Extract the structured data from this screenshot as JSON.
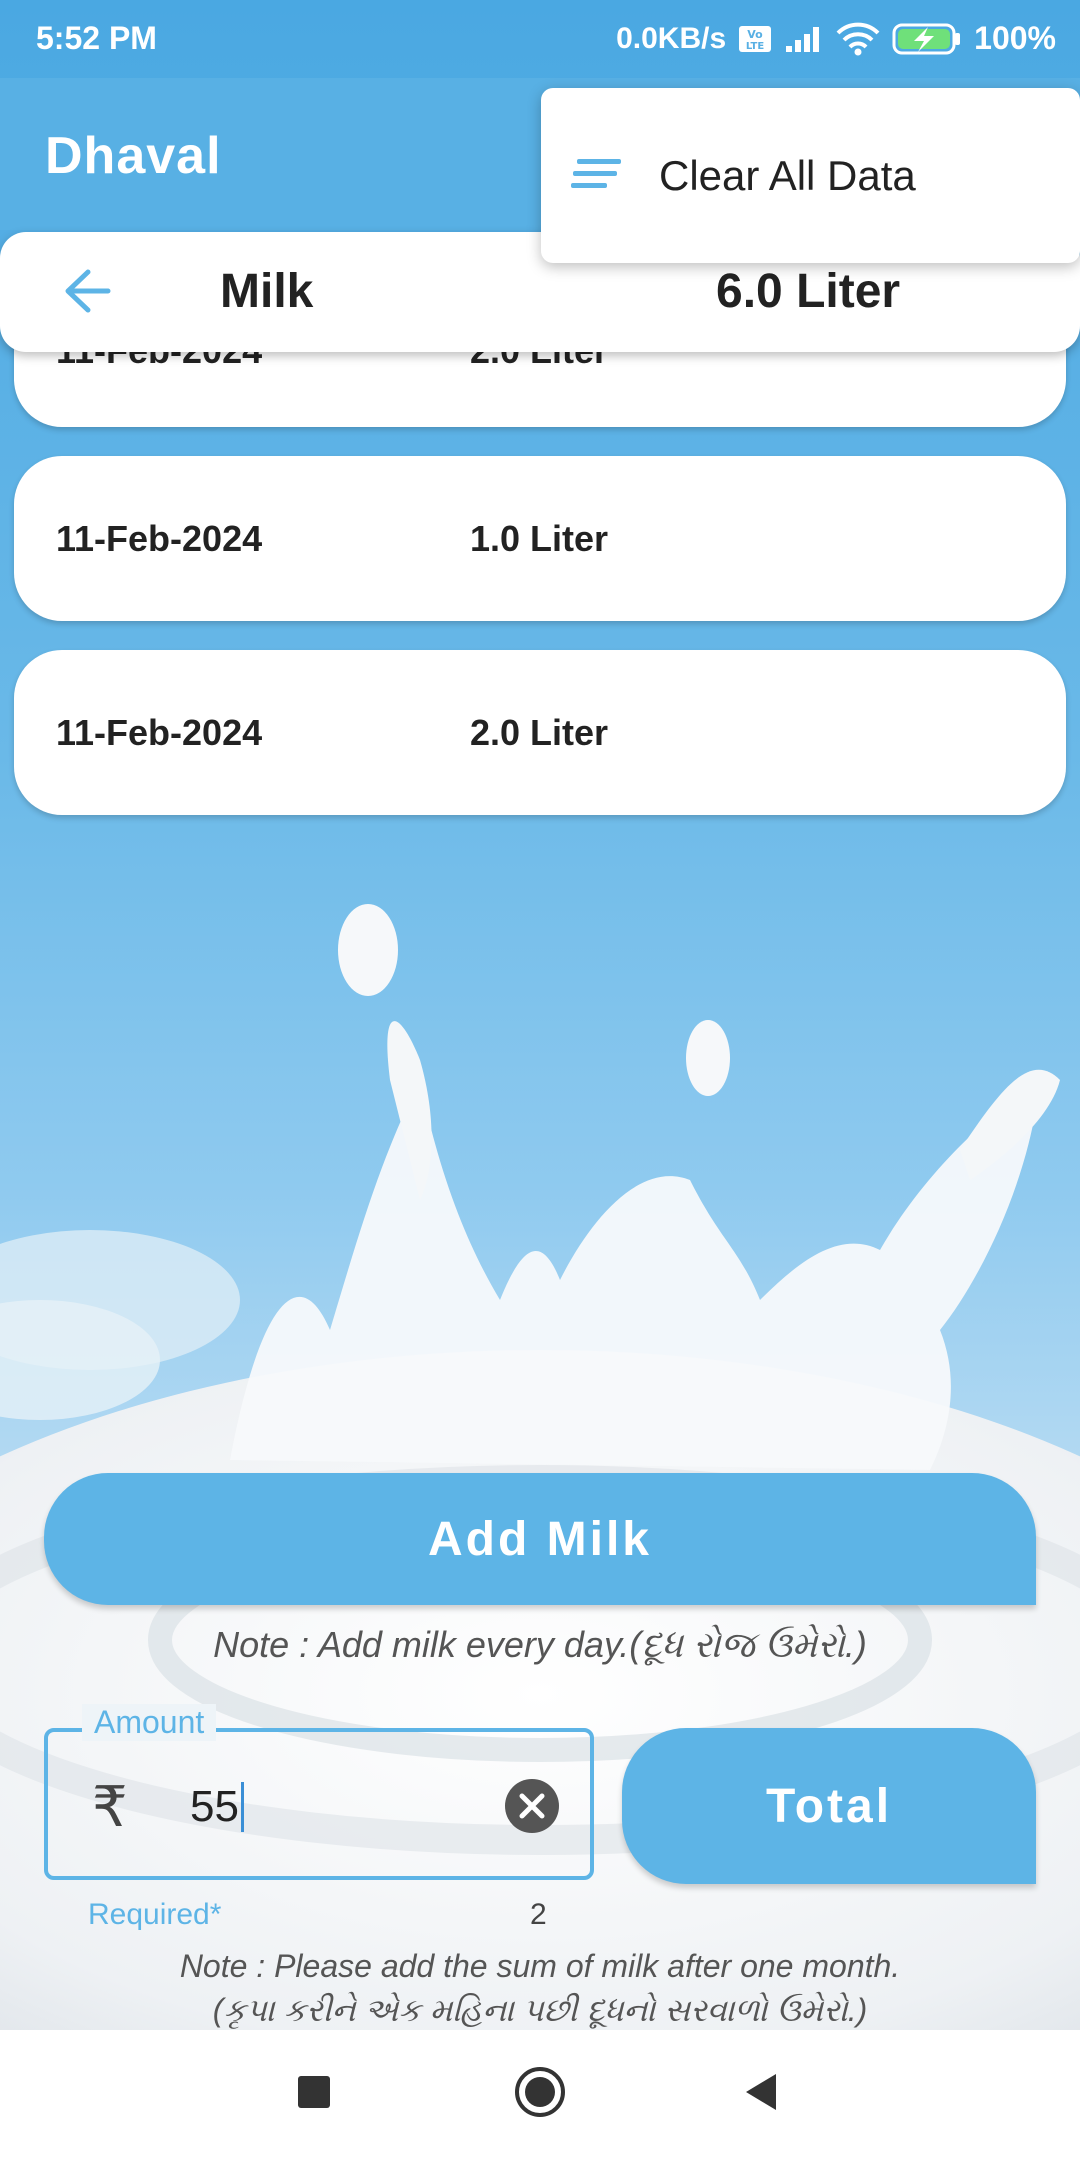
{
  "status_bar": {
    "time": "5:52 PM",
    "network_speed": "0.0KB/s",
    "battery": "100%",
    "icons": [
      "volte-icon",
      "signal-icon",
      "wifi-icon",
      "battery-charging-icon"
    ]
  },
  "app_bar": {
    "title": "Dhaval"
  },
  "menu": {
    "items": [
      {
        "label": "Clear All Data",
        "icon": "sort-lines-icon"
      }
    ]
  },
  "header": {
    "back_icon": "arrow-left-icon",
    "title": "Milk",
    "total": "6.0 Liter"
  },
  "entries": [
    {
      "date": "11-Feb-2024",
      "quantity": "2.0 Liter"
    },
    {
      "date": "11-Feb-2024",
      "quantity": "1.0 Liter"
    },
    {
      "date": "11-Feb-2024",
      "quantity": "2.0 Liter"
    }
  ],
  "add_button": {
    "label": "Add Milk"
  },
  "note_daily": "Note : Add milk every day.(દૂધ રોજ ઉમેરો.)",
  "amount_field": {
    "label": "Amount",
    "prefix": "₹",
    "value": "55",
    "helper": "Required*",
    "char_count": "2",
    "clear_icon": "clear-circle-icon"
  },
  "total_button": {
    "label": "Total"
  },
  "note_monthly_line1": "Note : Please add the sum of milk after one month.",
  "note_monthly_line2": "(કૃપા કરીને એક મહિના પછી દૂધનો સરવાળો ઉમેરો.)",
  "colors": {
    "primary": "#5db4e6",
    "app_bar": "#58b0e4"
  }
}
